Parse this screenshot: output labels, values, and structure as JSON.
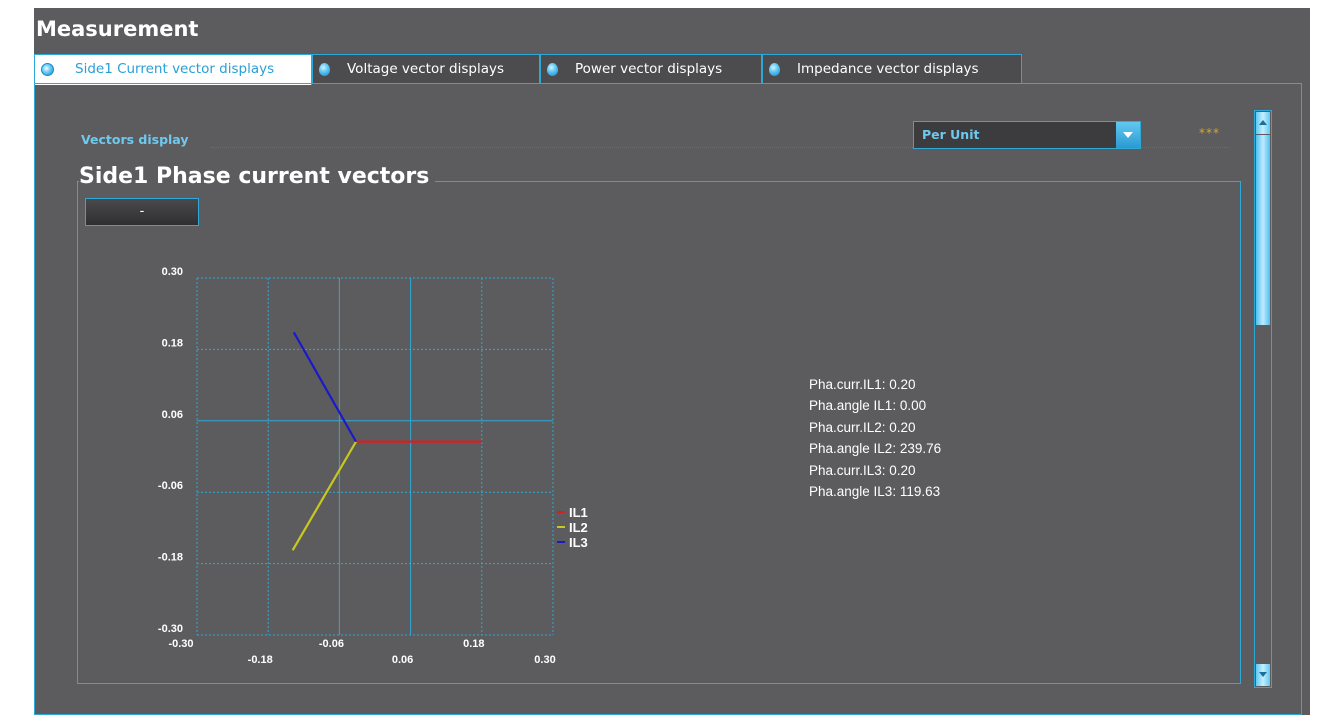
{
  "page": {
    "title": "Measurement"
  },
  "tabs": [
    {
      "label": "Side1 Current vector displays",
      "active": true
    },
    {
      "label": "Voltage vector displays",
      "active": false
    },
    {
      "label": "Power vector displays",
      "active": false
    },
    {
      "label": "Impedance vector displays",
      "active": false
    }
  ],
  "controls": {
    "vectors_display_label": "Vectors display",
    "unit_select_value": "Per Unit",
    "status_stars": "***"
  },
  "section": {
    "title": "Side1 Phase current vectors",
    "collapse_button_label": "-"
  },
  "readouts": [
    "Pha.curr.IL1: 0.20",
    "Pha.angle IL1: 0.00",
    "Pha.curr.IL2: 0.20",
    "Pha.angle IL2: 239.76",
    "Pha.curr.IL3: 0.20",
    "Pha.angle IL3: 119.63"
  ],
  "colors": {
    "accent": "#2ea8d6",
    "background": "#5c5c5e",
    "il1": "#d42020",
    "il2": "#c8c820",
    "il3": "#1a1ac8"
  },
  "chart_data": {
    "type": "scatter",
    "title": "",
    "xlim": [
      -0.3,
      0.3
    ],
    "ylim": [
      -0.3,
      0.3
    ],
    "x_ticks": [
      -0.3,
      -0.18,
      -0.06,
      0.06,
      0.18,
      0.3
    ],
    "x_tick_labels": [
      "-0.30",
      "-0.18",
      "-0.06",
      "0.06",
      "0.18",
      "0.30"
    ],
    "y_ticks": [
      0.3,
      0.18,
      0.06,
      -0.06,
      -0.18,
      -0.3
    ],
    "y_tick_labels": [
      "0.30",
      "0.18",
      "0.06",
      "-0.06",
      "-0.18",
      "-0.30"
    ],
    "grid": true,
    "legend": "right",
    "series": [
      {
        "name": "IL1",
        "magnitude": 0.2,
        "angle_deg": 0.0,
        "color": "#d42020"
      },
      {
        "name": "IL2",
        "magnitude": 0.2,
        "angle_deg": 239.76,
        "color": "#c8c820"
      },
      {
        "name": "IL3",
        "magnitude": 0.2,
        "angle_deg": 119.63,
        "color": "#1a1ac8"
      }
    ]
  }
}
